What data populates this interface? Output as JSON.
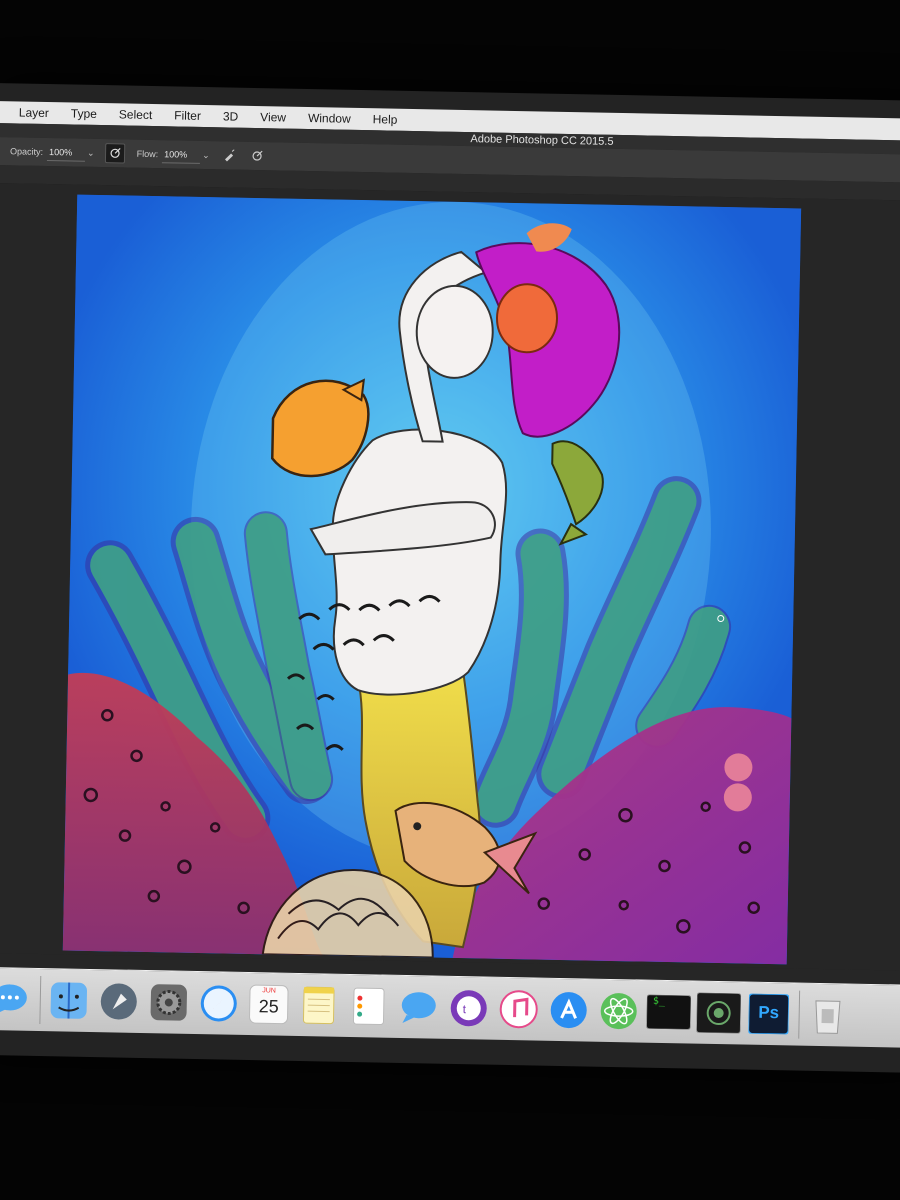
{
  "app": {
    "window_title": "Adobe Photoshop CC 2015.5"
  },
  "menubar": {
    "items": [
      "Layer",
      "Type",
      "Select",
      "Filter",
      "3D",
      "View",
      "Window",
      "Help"
    ]
  },
  "options_bar": {
    "opacity_label": "Opacity:",
    "opacity_value": "100%",
    "flow_label": "Flow:",
    "flow_value": "100%"
  },
  "canvas": {
    "artwork": "digital-painting-mermaid-underwater",
    "background_color": "#1a5fd6"
  },
  "dock": {
    "items": [
      {
        "icon": "messages-icon"
      },
      {
        "icon": "finder-icon"
      },
      {
        "icon": "launchpad-icon"
      },
      {
        "icon": "system-preferences-icon"
      },
      {
        "icon": "safari-icon"
      },
      {
        "icon": "calendar-icon",
        "month": "JUN",
        "day": "25"
      },
      {
        "icon": "notes-icon"
      },
      {
        "icon": "reminders-icon"
      },
      {
        "icon": "messages-icon"
      },
      {
        "icon": "twitter-client-icon"
      },
      {
        "icon": "itunes-icon"
      },
      {
        "icon": "app-store-icon"
      },
      {
        "icon": "atom-icon"
      },
      {
        "icon": "terminal-icon",
        "text": "$_"
      },
      {
        "icon": "activity-monitor-icon"
      },
      {
        "icon": "photoshop-icon",
        "text": "Ps"
      },
      {
        "icon": "trash-icon"
      }
    ]
  },
  "colors": {
    "menubar_bg": "#e8e8e8",
    "app_chrome": "#3a3a3a",
    "ocean_blue": "#1a5fd6",
    "hair_magenta": "#c21ec8",
    "tail_yellow": "#e0c84a",
    "seaweed_green": "#3f9e86",
    "coral_red": "#c0405a",
    "coral_purple": "#a0308a"
  }
}
